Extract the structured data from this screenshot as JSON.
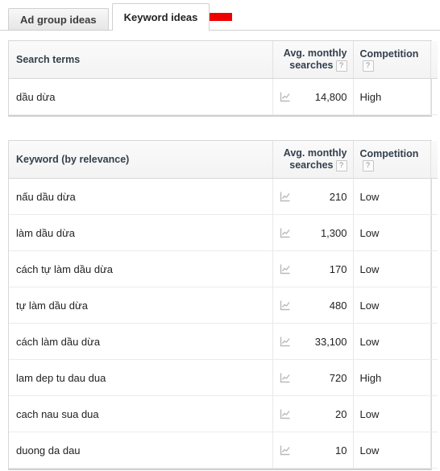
{
  "tabs": [
    {
      "label": "Ad group ideas",
      "active": false
    },
    {
      "label": "Keyword ideas",
      "active": true
    }
  ],
  "annotation": {
    "name": "red-left-arrow",
    "color": "#ee0000"
  },
  "icons": {
    "trend": "trend-chart-icon",
    "help": "?"
  },
  "search_terms_table": {
    "headers": {
      "term": "Search terms",
      "avg_line1": "Avg. monthly",
      "avg_line2": "searches",
      "competition": "Competition"
    },
    "rows": [
      {
        "term": "dầu dừa",
        "avg_monthly_searches": "14,800",
        "competition": "High"
      }
    ]
  },
  "keyword_ideas_table": {
    "headers": {
      "term": "Keyword (by relevance)",
      "avg_line1": "Avg. monthly",
      "avg_line2": "searches",
      "competition": "Competition"
    },
    "rows": [
      {
        "term": "nấu dầu dừa",
        "avg_monthly_searches": "210",
        "competition": "Low"
      },
      {
        "term": "làm dầu dừa",
        "avg_monthly_searches": "1,300",
        "competition": "Low"
      },
      {
        "term": "cách tự làm dầu dừa",
        "avg_monthly_searches": "170",
        "competition": "Low"
      },
      {
        "term": "tự làm dầu dừa",
        "avg_monthly_searches": "480",
        "competition": "Low"
      },
      {
        "term": "cách làm dầu dừa",
        "avg_monthly_searches": "33,100",
        "competition": "Low"
      },
      {
        "term": "lam dep tu dau dua",
        "avg_monthly_searches": "720",
        "competition": "High"
      },
      {
        "term": "cach nau sua dua",
        "avg_monthly_searches": "20",
        "competition": "Low"
      },
      {
        "term": "duong da dau",
        "avg_monthly_searches": "10",
        "competition": "Low"
      }
    ]
  }
}
